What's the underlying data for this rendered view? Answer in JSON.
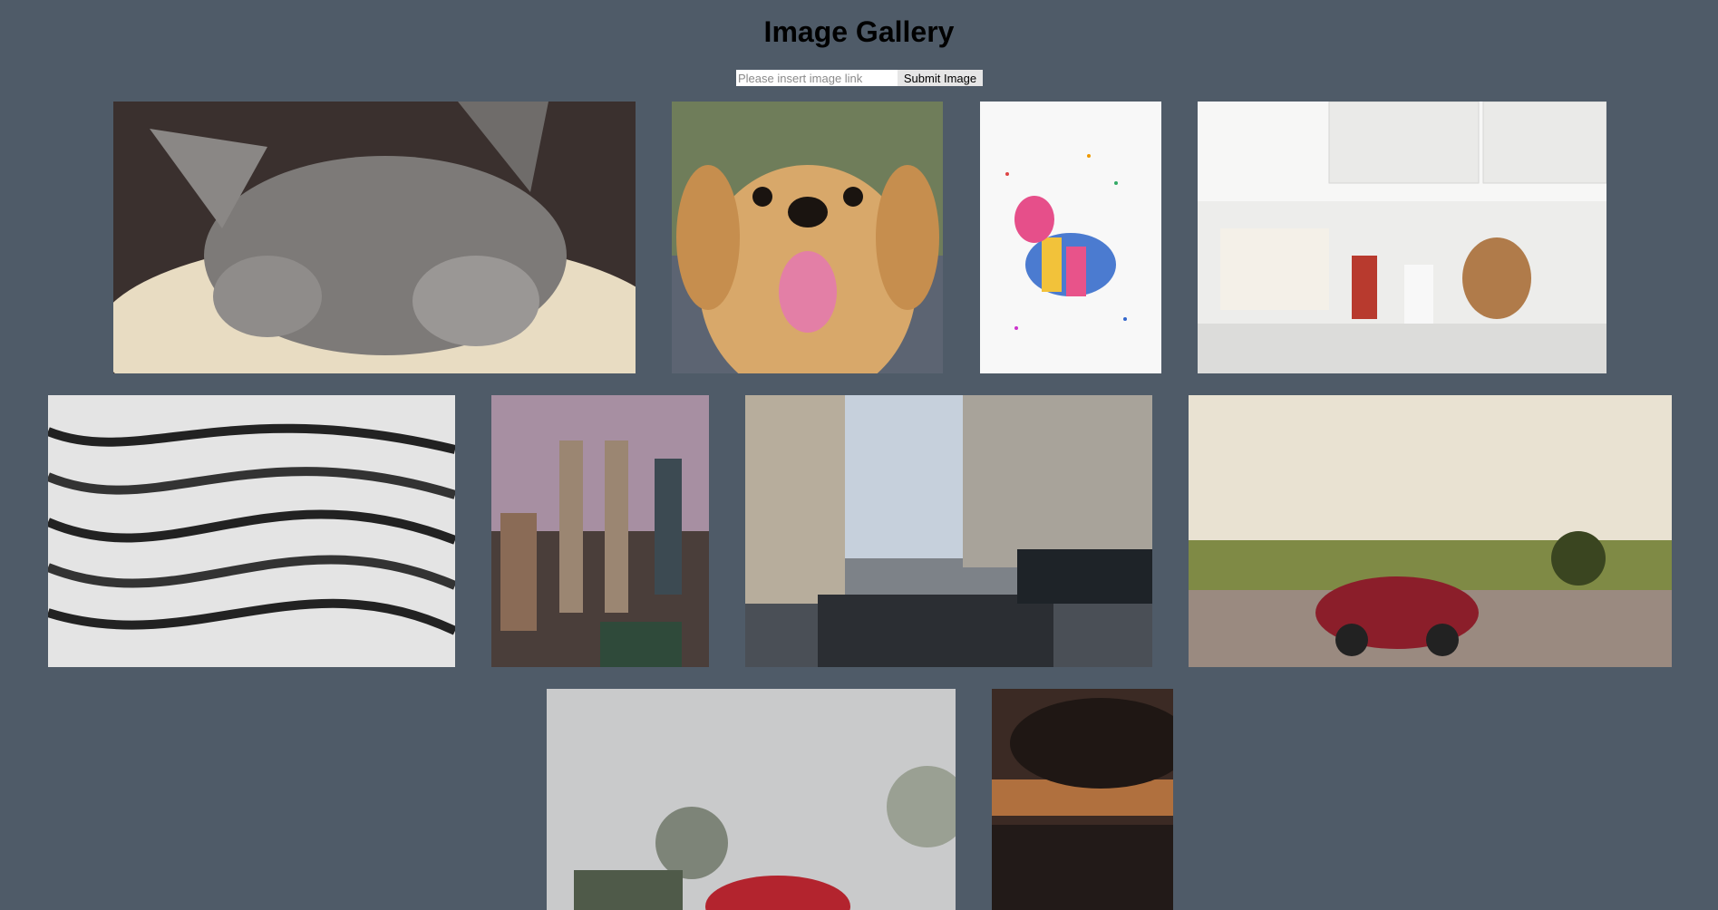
{
  "header": {
    "title": "Image Gallery"
  },
  "form": {
    "placeholder": "Please insert image link",
    "submit_label": "Submit Image"
  },
  "images": [
    {
      "subject": "kitten"
    },
    {
      "subject": "puppy"
    },
    {
      "subject": "pinata"
    },
    {
      "subject": "kitchen"
    },
    {
      "subject": "wave-pattern"
    },
    {
      "subject": "city-towers"
    },
    {
      "subject": "city-street"
    },
    {
      "subject": "red-car-sunset"
    },
    {
      "subject": "red-car-fog"
    },
    {
      "subject": "dark-sunset-sky"
    }
  ]
}
